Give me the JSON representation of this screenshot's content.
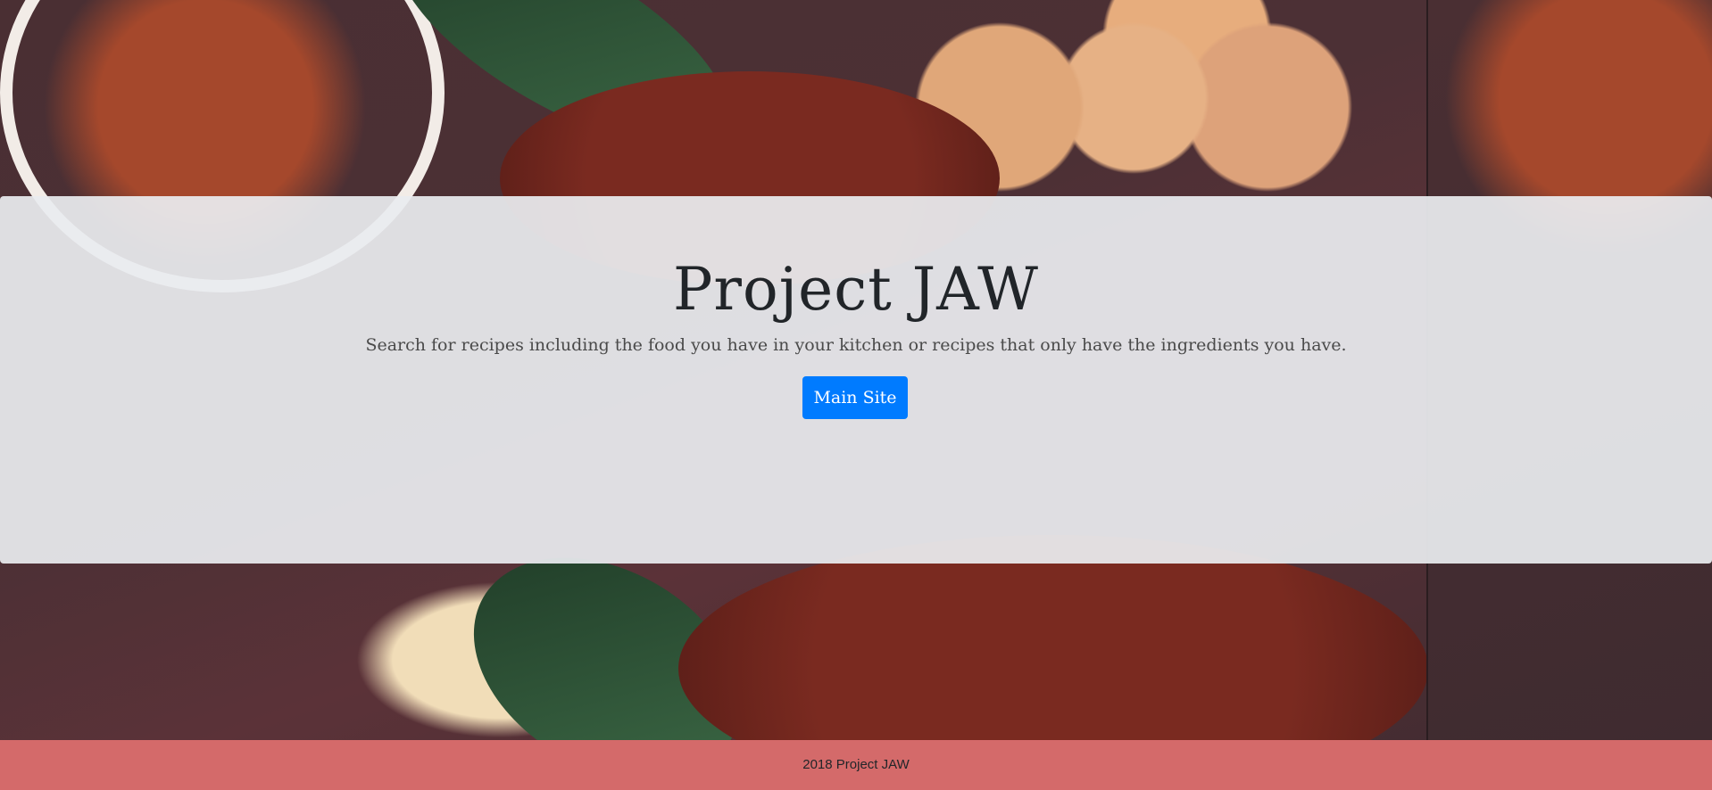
{
  "hero": {
    "title": "Project JAW",
    "lead": "Search for recipes including the food you have in your kitchen or recipes that only have the ingredients you have.",
    "button_label": "Main Site"
  },
  "footer": {
    "text": "2018 Project JAW"
  },
  "colors": {
    "button": "#007bff",
    "footer": "#d46a6a",
    "jumbotron": "#e9ecef"
  }
}
